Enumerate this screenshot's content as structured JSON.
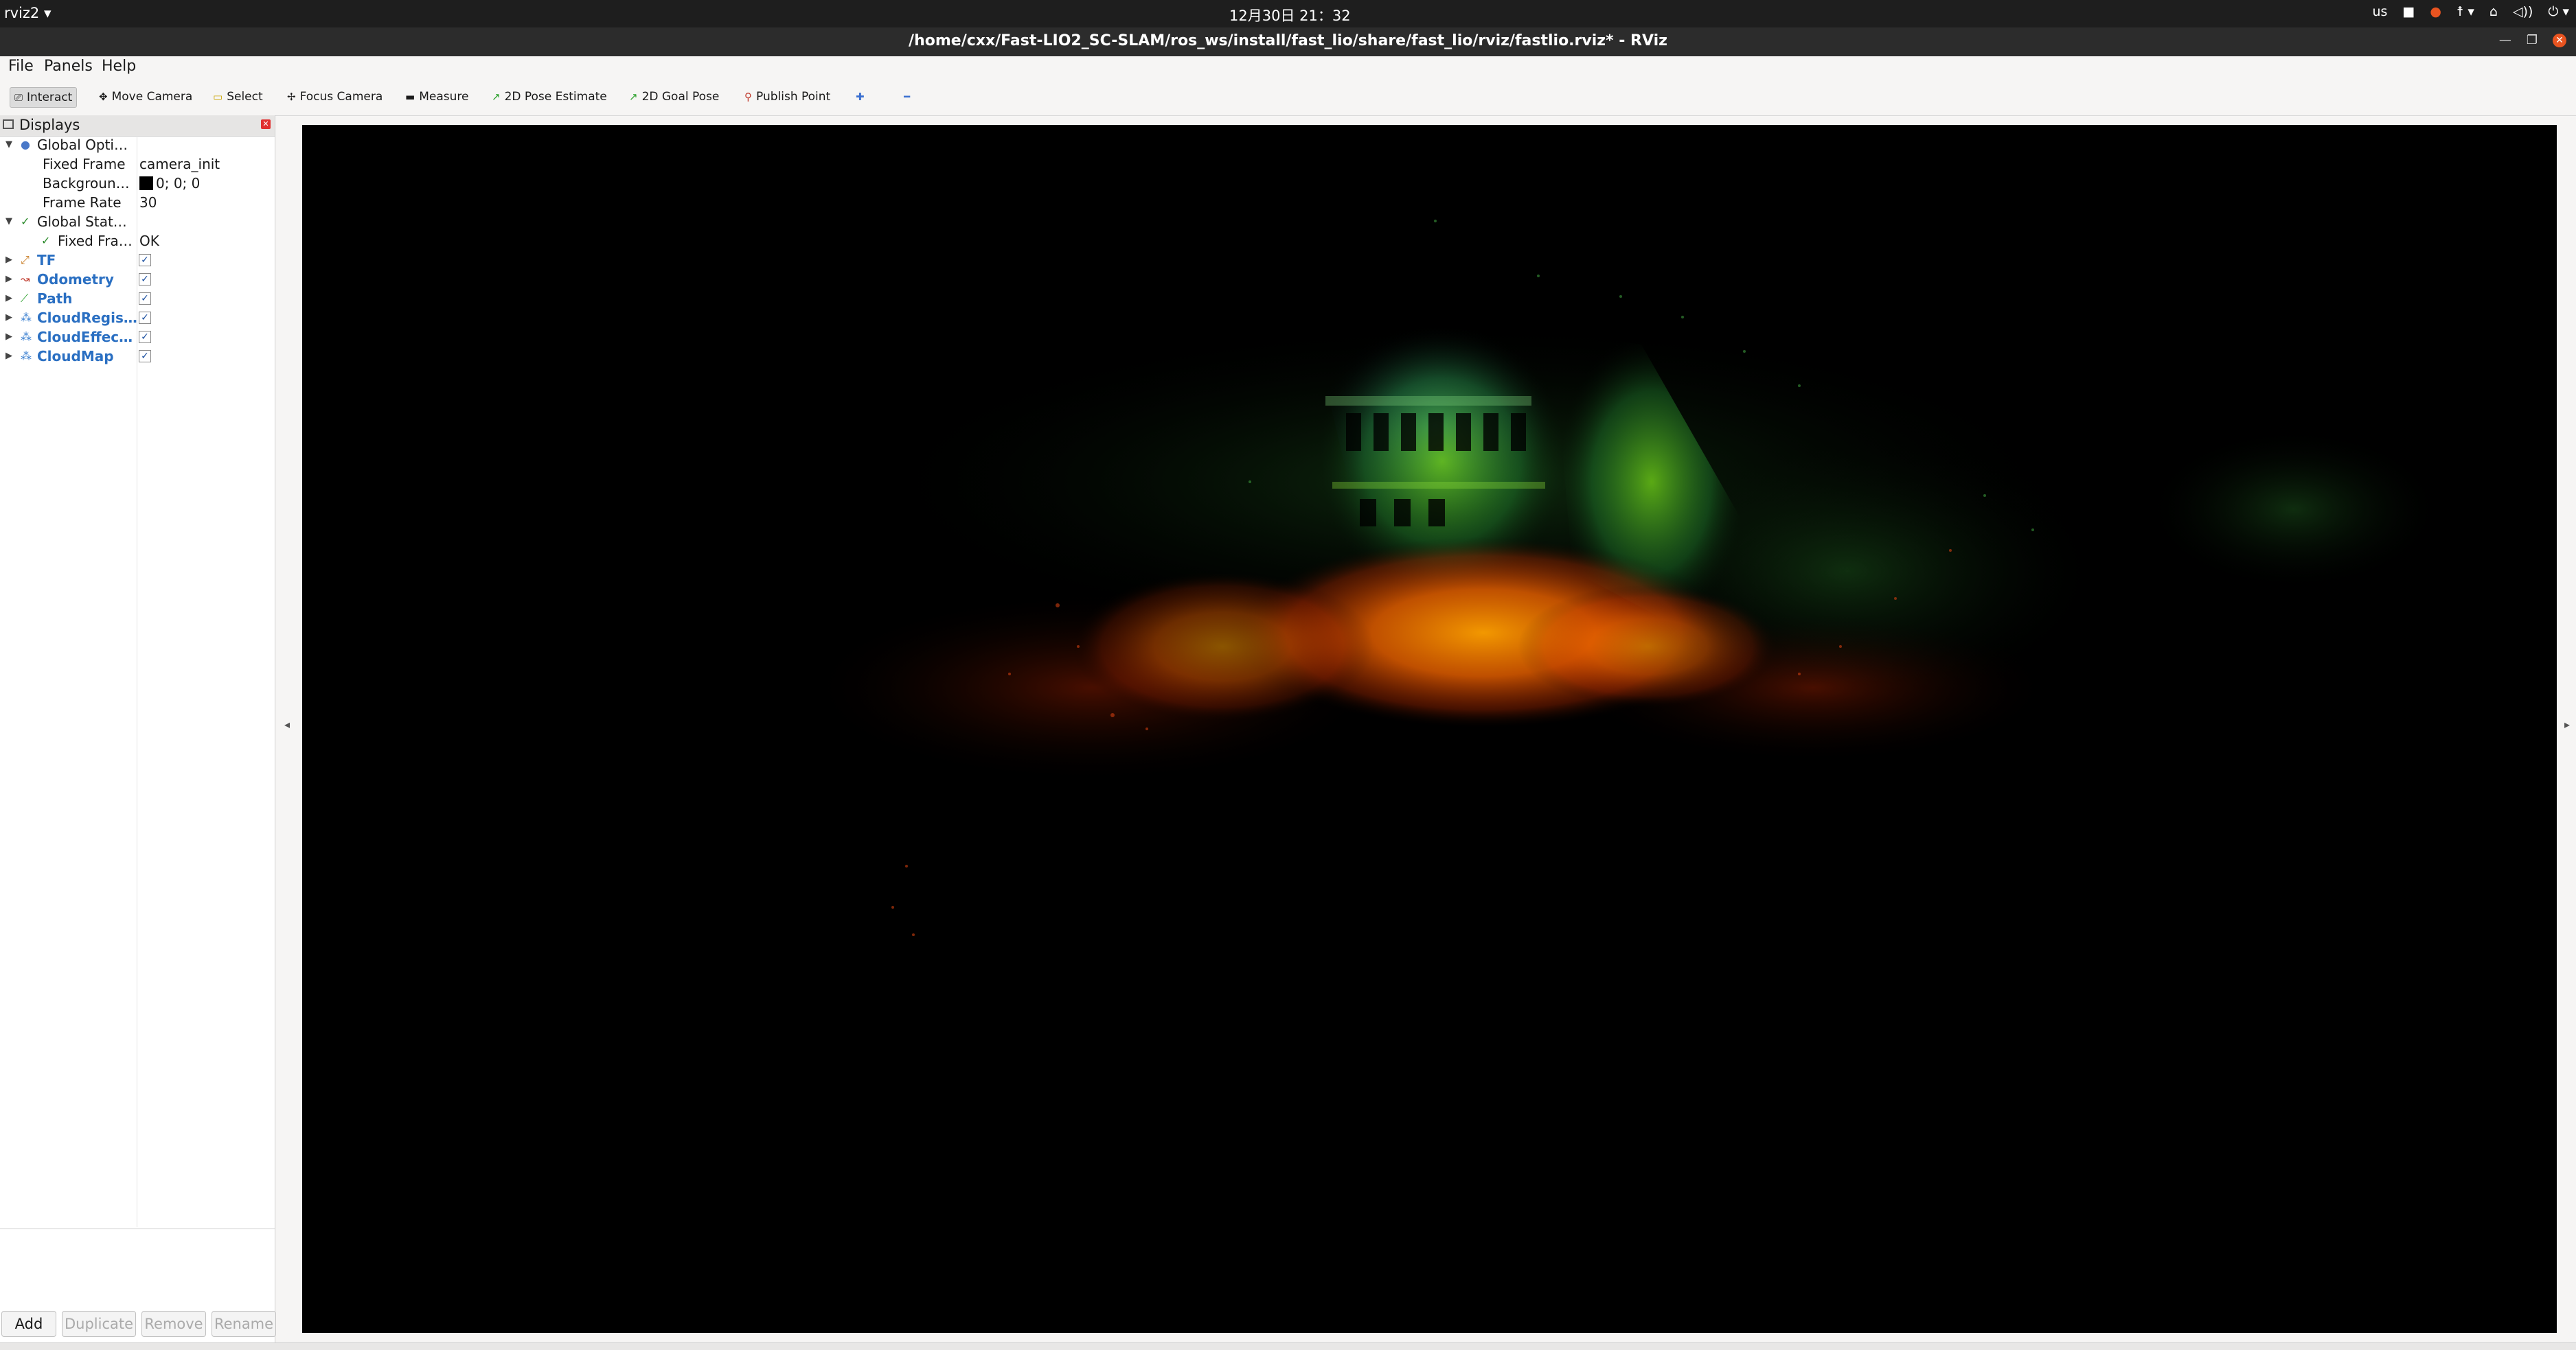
{
  "system_bar": {
    "app_menu": "rviz2 ▾",
    "clock": "12月30日  21：32",
    "tray": {
      "keyboard": "us",
      "icons": [
        "record-icon",
        "accessibility-icon",
        "network-icon",
        "volume-icon",
        "power-icon"
      ]
    }
  },
  "window": {
    "title": "/home/cxx/Fast-LIO2_SC-SLAM/ros_ws/install/fast_lio/share/fast_lio/rviz/fastlio.rviz* - RViz"
  },
  "menu": {
    "file": "File",
    "panels": "Panels",
    "help": "Help"
  },
  "toolbar": {
    "interact": "Interact",
    "move_camera": "Move Camera",
    "select": "Select",
    "focus_camera": "Focus Camera",
    "measure": "Measure",
    "pose_estimate": "2D Pose Estimate",
    "goal_pose": "2D Goal Pose",
    "publish_point": "Publish Point"
  },
  "displays": {
    "header": "Displays",
    "global_options": {
      "label": "Global Opti…",
      "fixed_frame_key": "Fixed Frame",
      "fixed_frame_val": "camera_init",
      "background_key": "Backgroun…",
      "background_val": "0; 0; 0",
      "frame_rate_key": "Frame Rate",
      "frame_rate_val": "30"
    },
    "global_status": {
      "label": "Global Stat…",
      "fixed_frame_key": "Fixed Fra…",
      "fixed_frame_val": "OK"
    },
    "items": [
      {
        "label": "TF",
        "icon": "tf-icon"
      },
      {
        "label": "Odometry",
        "icon": "odometry-icon"
      },
      {
        "label": "Path",
        "icon": "path-icon"
      },
      {
        "label": "CloudRegis…",
        "icon": "pointcloud-icon"
      },
      {
        "label": "CloudEffec…",
        "icon": "pointcloud-icon"
      },
      {
        "label": "CloudMap",
        "icon": "pointcloud-icon"
      }
    ]
  },
  "panel_buttons": {
    "add": "Add",
    "duplicate": "Duplicate",
    "remove": "Remove",
    "rename": "Rename"
  },
  "viewport": {
    "background": "#000000",
    "content": "point-cloud-map"
  }
}
